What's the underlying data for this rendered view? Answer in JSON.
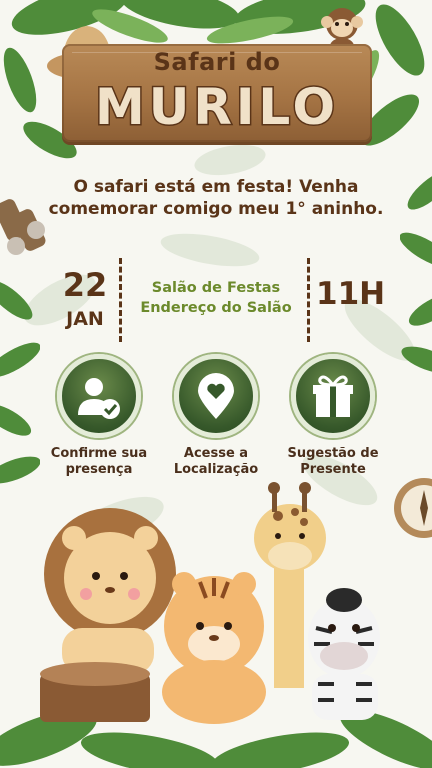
{
  "header": {
    "title_line1": "Safari do",
    "title_line2": "MURILO"
  },
  "invitation": {
    "message": "O safari está em festa! Venha comemorar comigo meu 1° aninho."
  },
  "event": {
    "day": "22",
    "month": "JAN",
    "venue_line1": "Salão de Festas",
    "venue_line2": "Endereço do Salão",
    "time": "11H"
  },
  "actions": [
    {
      "label": "Confirme sua presença",
      "icon": "user-check-icon"
    },
    {
      "label": "Acesse a Localização",
      "icon": "location-heart-icon"
    },
    {
      "label": "Sugestão de Presente",
      "icon": "gift-icon"
    }
  ],
  "colors": {
    "brown": "#5a3418",
    "green_text": "#6c8a2c",
    "button_green": "#36582a",
    "wood": "#a57444"
  }
}
